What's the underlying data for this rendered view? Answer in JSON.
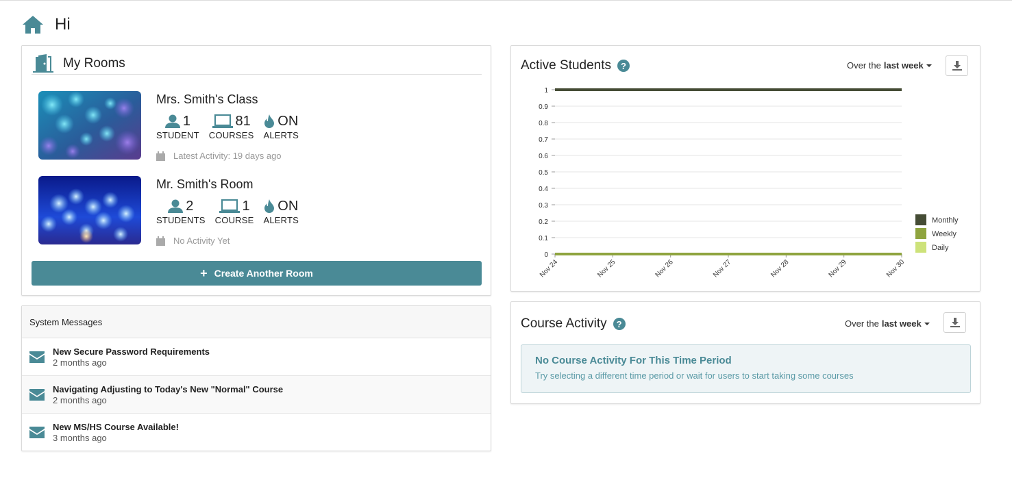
{
  "greeting": "Hi",
  "rooms_panel": {
    "title": "My Rooms",
    "rooms": [
      {
        "name": "Mrs. Smith's Class",
        "students_count": "1",
        "students_label": "STUDENT",
        "courses_count": "81",
        "courses_label": "COURSES",
        "alerts_value": "ON",
        "alerts_label": "ALERTS",
        "activity": "Latest Activity: 19 days ago"
      },
      {
        "name": "Mr. Smith's Room",
        "students_count": "2",
        "students_label": "STUDENTS",
        "courses_count": "1",
        "courses_label": "COURSE",
        "alerts_value": "ON",
        "alerts_label": "ALERTS",
        "activity": "No Activity Yet"
      }
    ],
    "create_button": "Create Another Room"
  },
  "system_messages": {
    "title": "System Messages",
    "items": [
      {
        "title": "New Secure Password Requirements",
        "date": "2 months ago"
      },
      {
        "title": "Navigating Adjusting to Today's New \"Normal\" Course",
        "date": "2 months ago"
      },
      {
        "title": "New MS/HS Course Available!",
        "date": "3 months ago"
      }
    ]
  },
  "active_students": {
    "title": "Active Students",
    "help": "?",
    "period_prefix": "Over the",
    "period_value": "last week"
  },
  "course_activity": {
    "title": "Course Activity",
    "help": "?",
    "period_prefix": "Over the",
    "period_value": "last week",
    "empty_title": "No Course Activity For This Time Period",
    "empty_desc": "Try selecting a different time period or wait for users to start taking some courses"
  },
  "colors": {
    "accent": "#4a8a96",
    "monthly": "#454c35",
    "weekly": "#8fa43f",
    "daily": "#cde27a"
  },
  "chart_data": {
    "type": "line",
    "categories": [
      "Nov 24",
      "Nov 25",
      "Nov 26",
      "Nov 27",
      "Nov 28",
      "Nov 29",
      "Nov 30"
    ],
    "series": [
      {
        "name": "Monthly",
        "values": [
          1,
          1,
          1,
          1,
          1,
          1,
          1
        ]
      },
      {
        "name": "Weekly",
        "values": [
          0,
          0,
          0,
          0,
          0,
          0,
          0
        ]
      },
      {
        "name": "Daily",
        "values": [
          0,
          0,
          0,
          0,
          0,
          0,
          0
        ]
      }
    ],
    "yticks": [
      "0",
      "0.1",
      "0.2",
      "0.3",
      "0.4",
      "0.5",
      "0.6",
      "0.7",
      "0.8",
      "0.9",
      "1"
    ],
    "ylim": [
      0,
      1
    ],
    "grid": true,
    "legend_position": "right"
  }
}
